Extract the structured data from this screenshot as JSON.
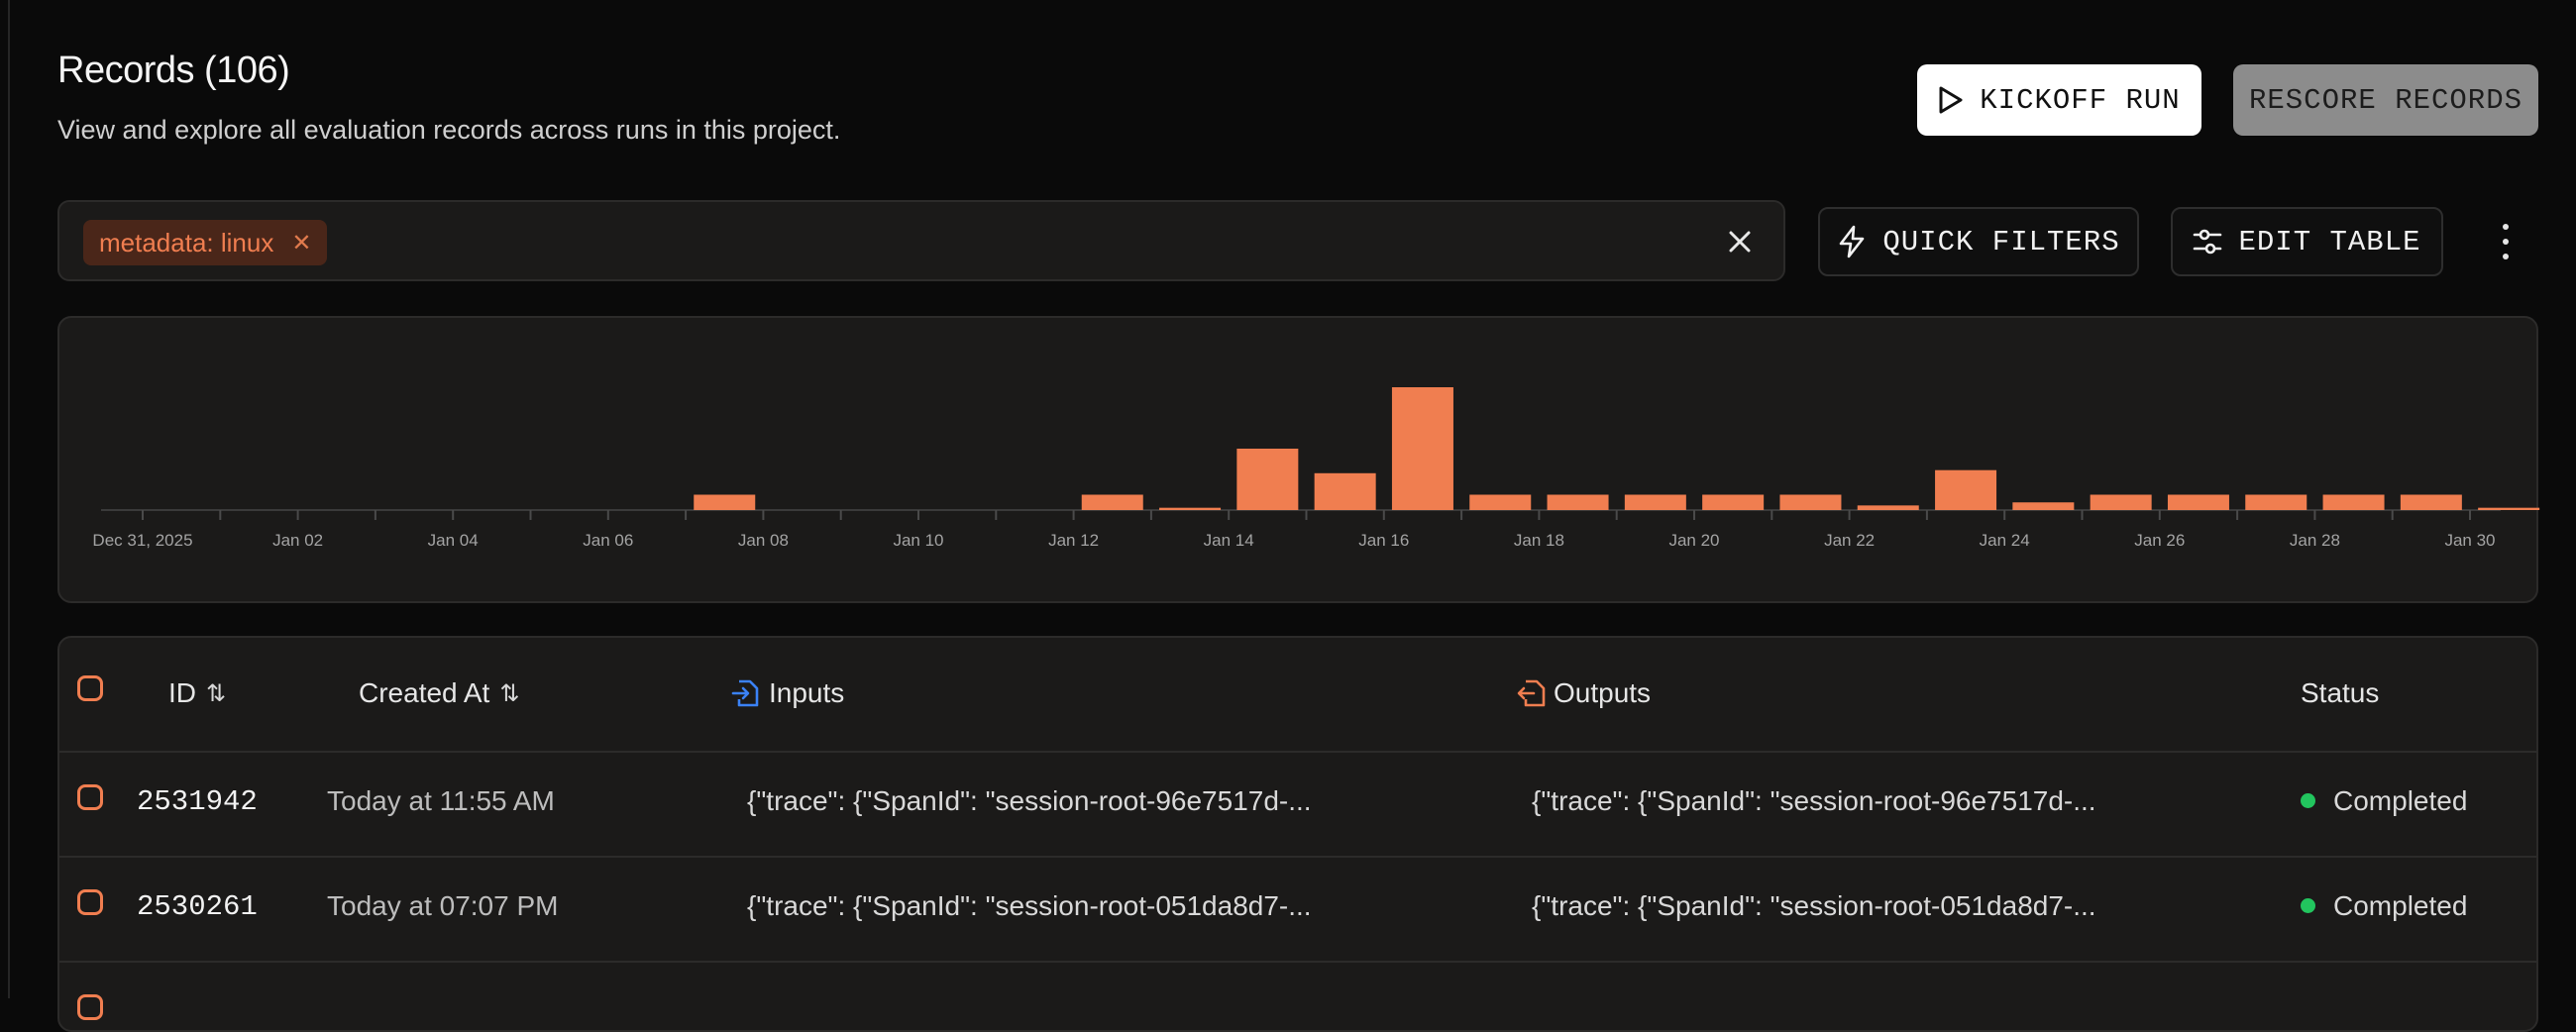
{
  "header": {
    "title": "Records (106)",
    "subtitle": "View and explore all evaluation records across runs in this project."
  },
  "actions": {
    "kickoff_label": "KICKOFF RUN",
    "rescore_label": "RESCORE RECORDS",
    "quick_filters_label": "QUICK FILTERS",
    "edit_table_label": "EDIT TABLE"
  },
  "filter": {
    "chip_label": "metadata: linux",
    "input_value": "",
    "input_placeholder": ""
  },
  "colors": {
    "accent": "#f07e50",
    "status_completed": "#22c55e",
    "inputs_icon": "#3b82f6",
    "outputs_icon": "#f07e50"
  },
  "icons": {
    "kickoff": "play-icon",
    "quick_filters": "lightning-icon",
    "edit_table": "sliders-icon",
    "more": "kebab-icon",
    "chip_remove": "close-icon",
    "search_clear": "close-icon",
    "inputs": "file-import-icon",
    "outputs": "file-export-icon"
  },
  "chart_data": {
    "type": "bar",
    "tick_labels": [
      "Dec 31, 2025",
      "Jan 02",
      "Jan 04",
      "Jan 06",
      "Jan 08",
      "Jan 10",
      "Jan 12",
      "Jan 14",
      "Jan 16",
      "Jan 18",
      "Jan 20",
      "Jan 22",
      "Jan 24",
      "Jan 26",
      "Jan 28",
      "Jan 30"
    ],
    "categories": [
      "Dec 31",
      "Jan 01",
      "Jan 02",
      "Jan 03",
      "Jan 04",
      "Jan 05",
      "Jan 06",
      "Jan 07",
      "Jan 08",
      "Jan 09",
      "Jan 10",
      "Jan 11",
      "Jan 12",
      "Jan 13",
      "Jan 14",
      "Jan 15",
      "Jan 16",
      "Jan 17",
      "Jan 18",
      "Jan 19",
      "Jan 20",
      "Jan 21",
      "Jan 22",
      "Jan 23",
      "Jan 24",
      "Jan 25",
      "Jan 26",
      "Jan 27",
      "Jan 28",
      "Jan 29",
      "Jan 30"
    ],
    "values": [
      0,
      0,
      0,
      0,
      0,
      0,
      0,
      2,
      0,
      0,
      0,
      0,
      2,
      0.3,
      8,
      4.8,
      16,
      2,
      2,
      2,
      2,
      2,
      0.6,
      5.2,
      1,
      2,
      2,
      2,
      2,
      2,
      0.3
    ],
    "ylim": [
      0,
      16
    ],
    "grid": false,
    "bar_color": "#f07e50"
  },
  "table": {
    "columns": {
      "id": "ID",
      "created_at": "Created At",
      "inputs": "Inputs",
      "outputs": "Outputs",
      "status": "Status"
    },
    "rows": [
      {
        "id": "2531942",
        "created_at": "Today at 11:55 AM",
        "inputs": "{\"trace\": {\"SpanId\": \"session-root-96e7517d-...",
        "outputs": "{\"trace\": {\"SpanId\": \"session-root-96e7517d-...",
        "status": "Completed"
      },
      {
        "id": "2530261",
        "created_at": "Today at 07:07 PM",
        "inputs": "{\"trace\": {\"SpanId\": \"session-root-051da8d7-...",
        "outputs": "{\"trace\": {\"SpanId\": \"session-root-051da8d7-...",
        "status": "Completed"
      }
    ]
  }
}
